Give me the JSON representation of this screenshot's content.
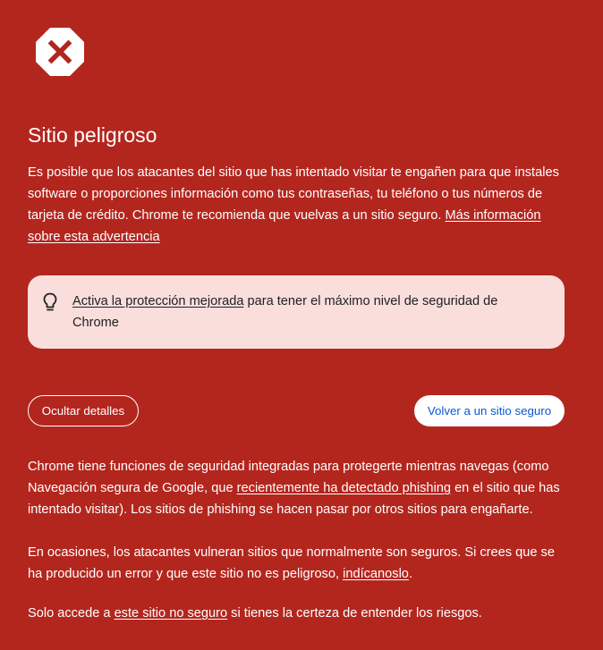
{
  "colors": {
    "background": "#b3261e",
    "callout_background": "#f9dedc",
    "primary_button_text": "#0b57d0"
  },
  "icons": {
    "warning": "octagon-x-icon",
    "tip": "lightbulb-icon"
  },
  "title": "Sitio peligroso",
  "intro": {
    "text": "Es posible que los atacantes del sitio que has intentado visitar te engañen para que instales software o proporciones información como tus contraseñas, tu teléfono o tus números de tarjeta de crédito. Chrome te recomienda que vuelvas a un sitio seguro. ",
    "link": "Más información sobre esta advertencia"
  },
  "callout": {
    "link": "Activa la protección mejorada",
    "text": " para tener el máximo nivel de seguridad de Chrome"
  },
  "buttons": {
    "details": "Ocultar detalles",
    "back": "Volver a un sitio seguro"
  },
  "details": {
    "p1_before": "Chrome tiene funciones de seguridad integradas para protegerte mientras navegas (como Navegación segura de Google, que ",
    "p1_link": "recientemente ha detectado phishing",
    "p1_after": " en el sitio que has intentado visitar). Los sitios de phishing se hacen pasar por otros sitios para engañarte.",
    "p2_before": "En ocasiones, los atacantes vulneran sitios que normalmente son seguros. Si crees que se ha producido un error y que este sitio no es peligroso, ",
    "p2_link": "indícanoslo",
    "p2_after": ".",
    "p3_before": "Solo accede a ",
    "p3_link": "este sitio no seguro",
    "p3_after": " si tienes la certeza de entender los riesgos."
  }
}
